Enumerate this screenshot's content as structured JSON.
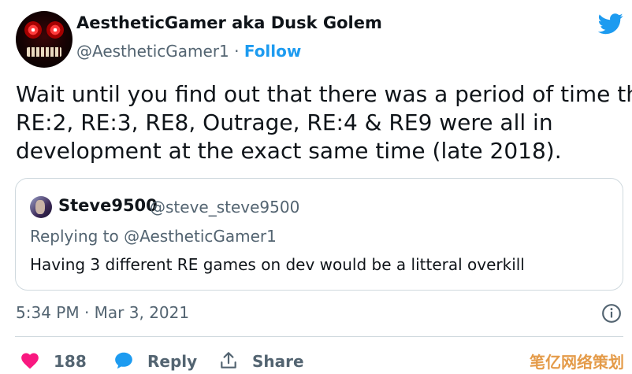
{
  "author": {
    "display_name": "AestheticGamer aka Dusk Golem",
    "handle": "@AestheticGamer1",
    "separator": "·",
    "follow_label": "Follow"
  },
  "tweet": {
    "lines": [
      "Wait until you find out that there was a period of time that",
      "RE:2, RE:3, RE8, Outrage, RE:4 & RE9 were all in",
      "development at the exact same time (late 2018)."
    ]
  },
  "quoted_tweet": {
    "display_name": "Steve9500",
    "handle": "@steve_steve9500",
    "replying_to": "Replying to @AestheticGamer1",
    "text": "Having 3 different RE games on dev would be a litteral overkill"
  },
  "timestamp": "5:34 PM · Mar 3, 2021",
  "actions": {
    "like_count": "188",
    "reply_label": "Reply",
    "share_label": "Share"
  },
  "watermark": "笔亿网络策划",
  "colors": {
    "accent": "#1d9bf0",
    "like": "#f91880",
    "text": "#0f1419",
    "secondary": "#536471",
    "border": "#cfd9de"
  },
  "icons": [
    "twitter-bird-icon",
    "info-icon",
    "heart-icon",
    "reply-bubble-icon",
    "share-icon"
  ]
}
